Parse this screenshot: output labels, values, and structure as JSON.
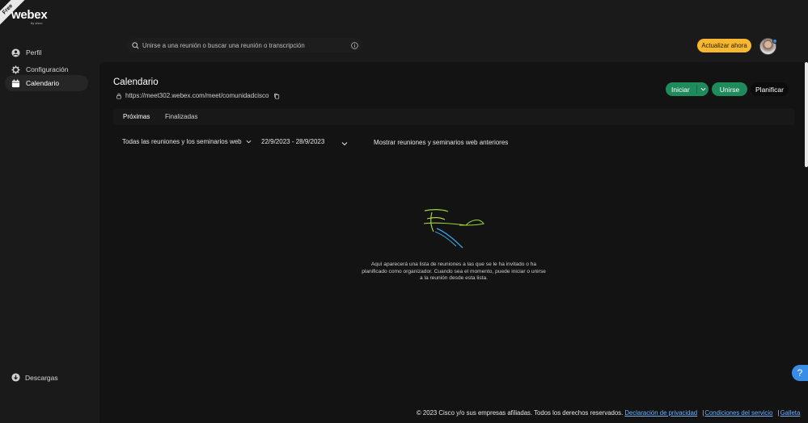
{
  "brand": {
    "ribbon": "Free",
    "logo": "webex",
    "logo_sub": "by cisco"
  },
  "sidebar": {
    "items": [
      {
        "label": "Perfil",
        "icon": "profile-icon"
      },
      {
        "label": "Configuración",
        "icon": "gear-icon"
      },
      {
        "label": "Calendario",
        "icon": "calendar-icon",
        "active": true
      }
    ],
    "downloads": {
      "label": "Descargas",
      "icon": "download-icon"
    }
  },
  "header": {
    "search": {
      "placeholder": "Unirse a una reunión o buscar una reunión o transcripción"
    },
    "upgrade_label": "Actualizar ahora"
  },
  "main": {
    "title": "Calendario",
    "room_url": "https://meet302.webex.com/meet/comunidadcisco",
    "actions": {
      "start": "Iniciar",
      "join": "Unirse",
      "schedule": "Planificar"
    },
    "tabs": [
      {
        "label": "Próximas",
        "active": true
      },
      {
        "label": "Finalizadas"
      }
    ],
    "filters": {
      "type": "Todas las reuniones y los seminarios web",
      "date_range": "22/9/2023 - 28/9/2023",
      "show_past": "Mostrar reuniones y seminarios web anteriores"
    },
    "empty_message": "Aquí aparecerá una lista de reuniones a las que se le ha invitado o ha planificado como organizador. Cuando sea el momento, puede iniciar o unirse a la reunión desde esta lista."
  },
  "help": {
    "label": "?"
  },
  "footer": {
    "copyright": "© 2023 Cisco y/o sus empresas afiliadas. Todos los derechos reservados.",
    "links": [
      "Declaración de privacidad",
      "Condiciones del servicio",
      "Galleta"
    ]
  },
  "colors": {
    "accent_green": "#1f8a5c",
    "upgrade_yellow": "#f7b731",
    "link_blue": "#6fb0ff",
    "help_blue": "#3a8de6"
  }
}
